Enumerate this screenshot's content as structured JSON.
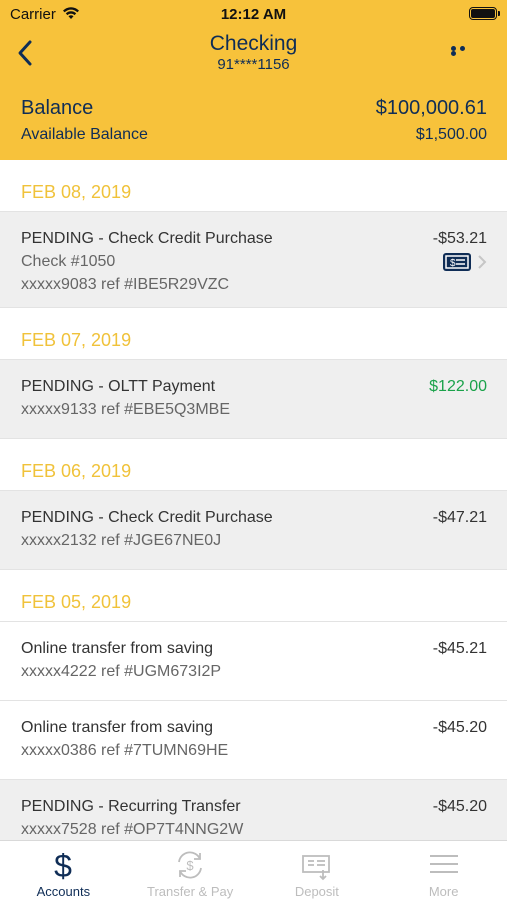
{
  "status_bar": {
    "carrier": "Carrier",
    "time": "12:12 AM"
  },
  "nav": {
    "title": "Checking",
    "subtitle": "91****1156"
  },
  "balance": {
    "label": "Balance",
    "value": "$100,000.61",
    "available_label": "Available Balance",
    "available_value": "$1,500.00"
  },
  "groups": [
    {
      "date": "FEB 08, 2019",
      "transactions": [
        {
          "description": "PENDING - Check Credit Purchase",
          "check": "Check #1050",
          "ref": "xxxxx9083 ref #IBE5R29VZC",
          "amount": "-$53.21"
        }
      ]
    },
    {
      "date": "FEB 07, 2019",
      "transactions": [
        {
          "description": "PENDING - OLTT Payment",
          "ref": "xxxxx9133 ref #EBE5Q3MBE",
          "amount": "$122.00"
        }
      ]
    },
    {
      "date": "FEB 06, 2019",
      "transactions": [
        {
          "description": "PENDING - Check Credit Purchase",
          "ref": "xxxxx2132 ref #JGE67NE0J",
          "amount": "-$47.21"
        }
      ]
    },
    {
      "date": "FEB 05, 2019",
      "transactions": [
        {
          "description": "Online transfer from saving",
          "ref": "xxxxx4222 ref #UGM673I2P",
          "amount": "-$45.21"
        },
        {
          "description": "Online transfer from saving",
          "ref": "xxxxx0386 ref #7TUMN69HE",
          "amount": "-$45.20"
        },
        {
          "description": "PENDING - Recurring Transfer",
          "ref": "xxxxx7528 ref #OP7T4NNG2W",
          "amount": "-$45.20"
        }
      ]
    }
  ],
  "tabs": [
    {
      "label": "Accounts",
      "icon": "dollar-icon",
      "active": true
    },
    {
      "label": "Transfer & Pay",
      "icon": "transfer-icon",
      "active": false
    },
    {
      "label": "Deposit",
      "icon": "deposit-icon",
      "active": false
    },
    {
      "label": "More",
      "icon": "menu-icon",
      "active": false
    }
  ],
  "colors": {
    "header_bg": "#f7c23b",
    "navy": "#0f2d56",
    "date_yellow": "#f0c23a",
    "positive_green": "#1aa24a",
    "pending_bg": "#efefef"
  }
}
